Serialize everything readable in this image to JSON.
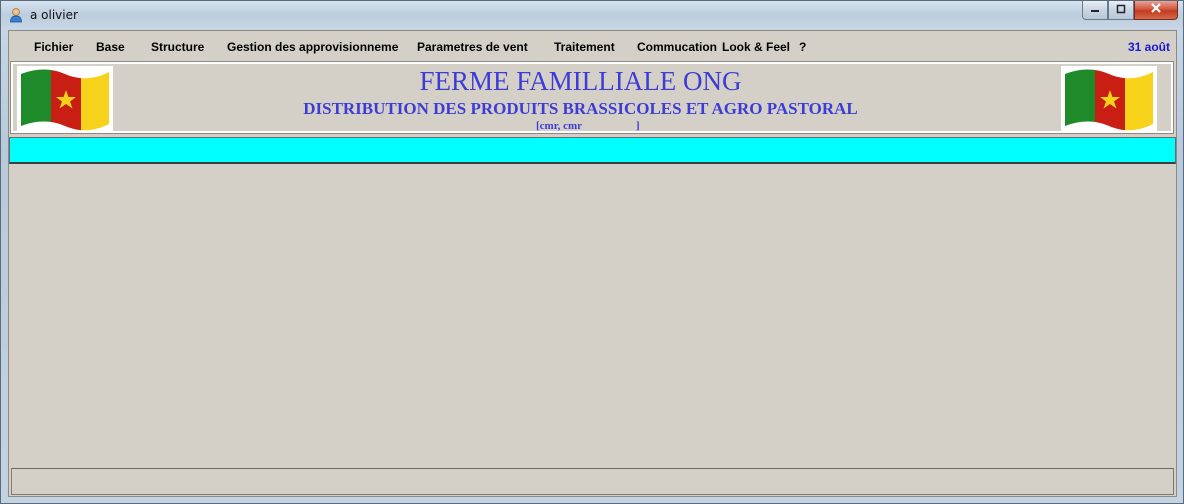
{
  "window": {
    "title": "a olivier",
    "app_icon": "user-icon"
  },
  "caption_buttons": {
    "minimize_icon": "minimize-icon",
    "maximize_icon": "maximize-icon",
    "close_icon": "close-icon"
  },
  "menu": {
    "items": [
      {
        "label": "Fichier"
      },
      {
        "label": "Base"
      },
      {
        "label": "Structure"
      },
      {
        "label": "Gestion des approvisionneme"
      },
      {
        "label": "Parametres de vent"
      },
      {
        "label": "Traitement"
      },
      {
        "label": "Commucation"
      },
      {
        "label": "Look & Feel"
      },
      {
        "label": "?"
      }
    ],
    "date": "31 août"
  },
  "banner": {
    "title": "FERME FAMILLIALE ONG",
    "subtitle": "DISTRIBUTION DES PRODUITS BRASSICOLES ET AGRO PASTORAL",
    "code_open": "[cmr, cmr",
    "code_close": "]",
    "flag_icon": "cameroon-flag-icon",
    "text_color": "#3d3dd6"
  },
  "colors": {
    "toolbar": "#00ffff",
    "client_bg": "#d4d0c8",
    "menu_date": "#1a1ad2"
  }
}
